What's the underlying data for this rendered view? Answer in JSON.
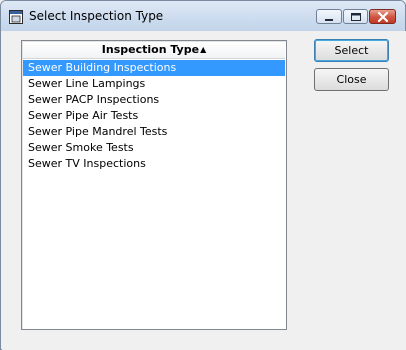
{
  "window": {
    "title": "Select Inspection Type"
  },
  "list": {
    "column_header": "Inspection Type",
    "sort_indicator": "▲",
    "items": [
      "Sewer Building Inspections",
      "Sewer Line Lampings",
      "Sewer PACP Inspections",
      "Sewer Pipe Air Tests",
      "Sewer Pipe Mandrel Tests",
      "Sewer Smoke Tests",
      "Sewer TV Inspections"
    ],
    "selected_index": 0
  },
  "buttons": {
    "select_label": "Select",
    "close_label": "Close"
  },
  "colors": {
    "selection": "#3399ff",
    "window_bg": "#f0f0f0"
  },
  "icons": {
    "app": "app-window-icon",
    "minimize": "minimize-icon",
    "maximize": "maximize-icon",
    "close": "close-icon"
  }
}
